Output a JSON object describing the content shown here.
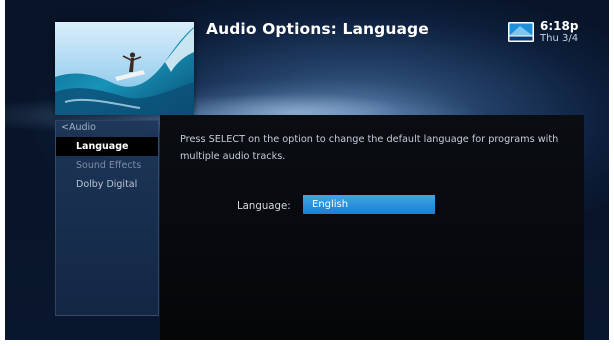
{
  "header": {
    "title": "Audio Options: Language",
    "logo_icon": "directv-logo-icon",
    "time": "6:18p",
    "date": "Thu 3/4"
  },
  "thumbnail": {
    "icon": "surfer-preview-image"
  },
  "sidebar": {
    "back_label": "<Audio",
    "items": [
      {
        "label": "Language",
        "state": "selected"
      },
      {
        "label": "Sound Effects",
        "state": "dim"
      },
      {
        "label": "Dolby Digital",
        "state": "normal"
      }
    ]
  },
  "content": {
    "instruction": "Press SELECT on the option to change the default language for programs with multiple audio tracks.",
    "language_label": "Language:",
    "language_value": "English"
  },
  "colors": {
    "accent": "#1f8ad6",
    "background": "#0d1f3c",
    "panel": "#07090c"
  }
}
